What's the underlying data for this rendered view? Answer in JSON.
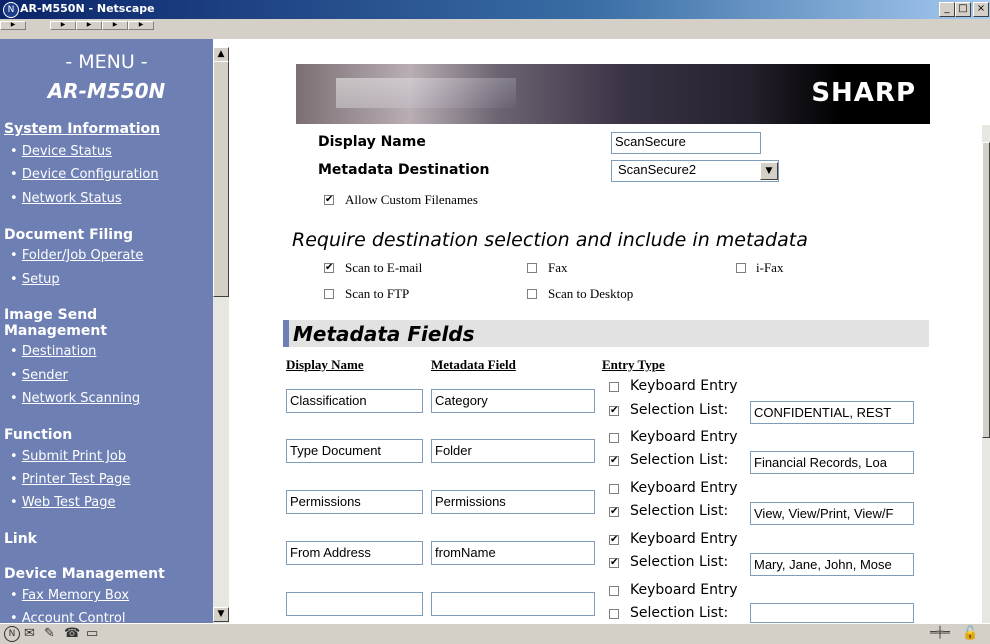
{
  "window": {
    "title": "AR-M550N - Netscape",
    "buttons": [
      "_",
      "□",
      "×"
    ]
  },
  "menu": {
    "title": "- MENU -",
    "model": "AR-M550N",
    "sections": [
      {
        "label": "System Information",
        "items": [
          "Device Status",
          "Device Configuration",
          "Network Status"
        ]
      },
      {
        "label": "Document Filing",
        "items": [
          "Folder/Job Operate",
          "Setup"
        ]
      },
      {
        "label": "Image Send Management",
        "items": [
          "Destination",
          "Sender",
          "Network Scanning"
        ]
      },
      {
        "label": "Function",
        "items": [
          "Submit Print Job",
          "Printer Test Page",
          "Web Test Page"
        ]
      },
      {
        "label": "Link",
        "items": []
      },
      {
        "label": "Device Management",
        "items": [
          "Fax Memory Box",
          "Account Control"
        ]
      }
    ]
  },
  "banner": {
    "brand": "SHARP"
  },
  "form": {
    "display_name_label": "Display Name",
    "display_name_value": "ScanSecure",
    "metadata_dest_label": "Metadata Destination",
    "metadata_dest_value": "ScanSecure2",
    "allow_custom_filenames": {
      "label": "Allow Custom Filenames",
      "checked": true
    }
  },
  "require": {
    "heading": "Require destination selection and include in metadata",
    "options": [
      {
        "label": "Scan to E-mail",
        "checked": true
      },
      {
        "label": "Fax",
        "checked": false
      },
      {
        "label": "i-Fax",
        "checked": false
      },
      {
        "label": "Scan to FTP",
        "checked": false
      },
      {
        "label": "Scan to Desktop",
        "checked": false
      }
    ]
  },
  "metadata": {
    "heading": "Metadata Fields",
    "columns": [
      "Display Name",
      "Metadata Field",
      "Entry Type"
    ],
    "keyboard_label": "Keyboard Entry",
    "selection_label": "Selection List:",
    "rows": [
      {
        "display": "Classification",
        "field": "Category",
        "keyboard": false,
        "selection": true,
        "list": "CONFIDENTIAL, REST"
      },
      {
        "display": "Type Document",
        "field": "Folder",
        "keyboard": false,
        "selection": true,
        "list": "Financial Records, Loa"
      },
      {
        "display": "Permissions",
        "field": "Permissions",
        "keyboard": false,
        "selection": true,
        "list": "View, View/Print, View/F"
      },
      {
        "display": "From Address",
        "field": "fromName",
        "keyboard": true,
        "selection": true,
        "list": "Mary, Jane, John, Mose"
      },
      {
        "display": "",
        "field": "",
        "keyboard": false,
        "selection": false,
        "list": ""
      }
    ]
  },
  "status_icons": [
    "netscape-icon",
    "mail-icon",
    "composer-icon",
    "addressbook-icon",
    "tasks-icon",
    "offline-icon",
    "lock-icon"
  ]
}
